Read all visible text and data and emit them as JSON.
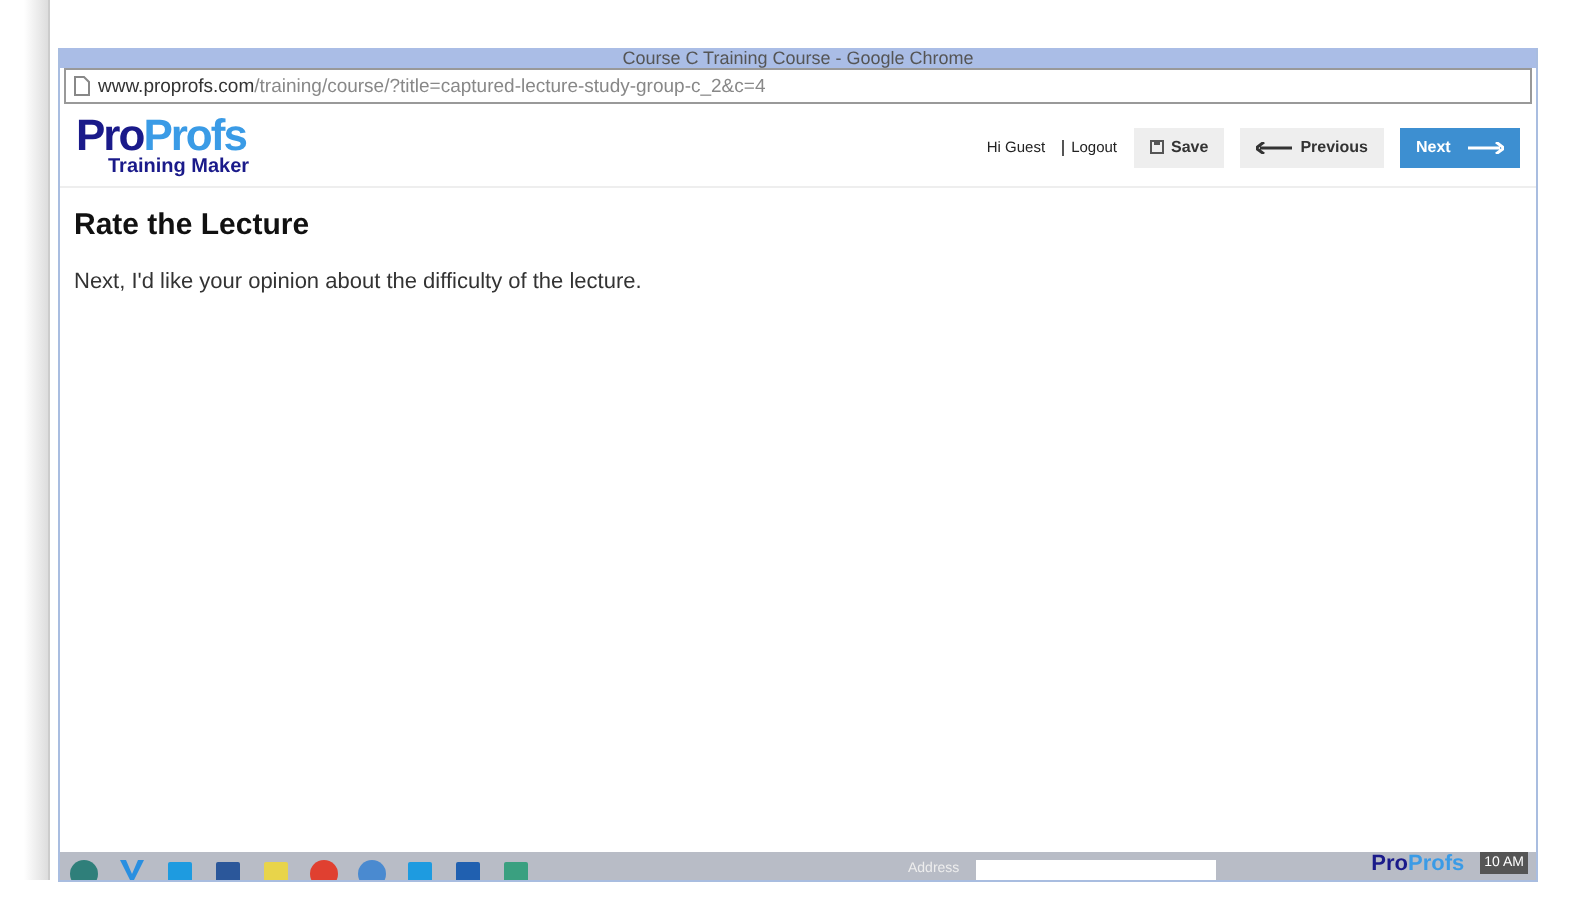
{
  "window": {
    "title": "Course C Training Course - Google Chrome"
  },
  "address_bar": {
    "host": "www.proprofs.com",
    "path": "/training/course/?title=captured-lecture-study-group-c_2&c=4"
  },
  "header": {
    "logo": {
      "pro": "Pro",
      "profs": "Profs",
      "subtitle": "Training Maker"
    },
    "greeting": "Hi Guest",
    "logout": "Logout",
    "buttons": [
      {
        "kind": "save",
        "label": "Save"
      },
      {
        "kind": "previous",
        "label": "Previous"
      },
      {
        "kind": "next",
        "label": "Next"
      }
    ]
  },
  "content": {
    "heading": "Rate the Lecture",
    "text": "Next, I'd like your opinion about the difficulty of the lecture."
  },
  "taskbar": {
    "apps": [
      {
        "kind": "circle",
        "color": "#2f7f7a"
      },
      {
        "kind": "v",
        "color": "#2a8fe0"
      },
      {
        "kind": "square",
        "color": "#1e9be0"
      },
      {
        "kind": "square",
        "color": "#2b579a"
      },
      {
        "kind": "square",
        "color": "#e8d44a"
      },
      {
        "kind": "circle",
        "color": "#e04030"
      },
      {
        "kind": "circle",
        "color": "#4a8ad0"
      },
      {
        "kind": "square",
        "color": "#1e9be0"
      },
      {
        "kind": "square",
        "color": "#2060b0"
      },
      {
        "kind": "square",
        "color": "#3aa080"
      }
    ],
    "address_label": "Address",
    "badge": {
      "pro": "Pro",
      "profs": "Profs"
    },
    "clock": "10 AM"
  }
}
